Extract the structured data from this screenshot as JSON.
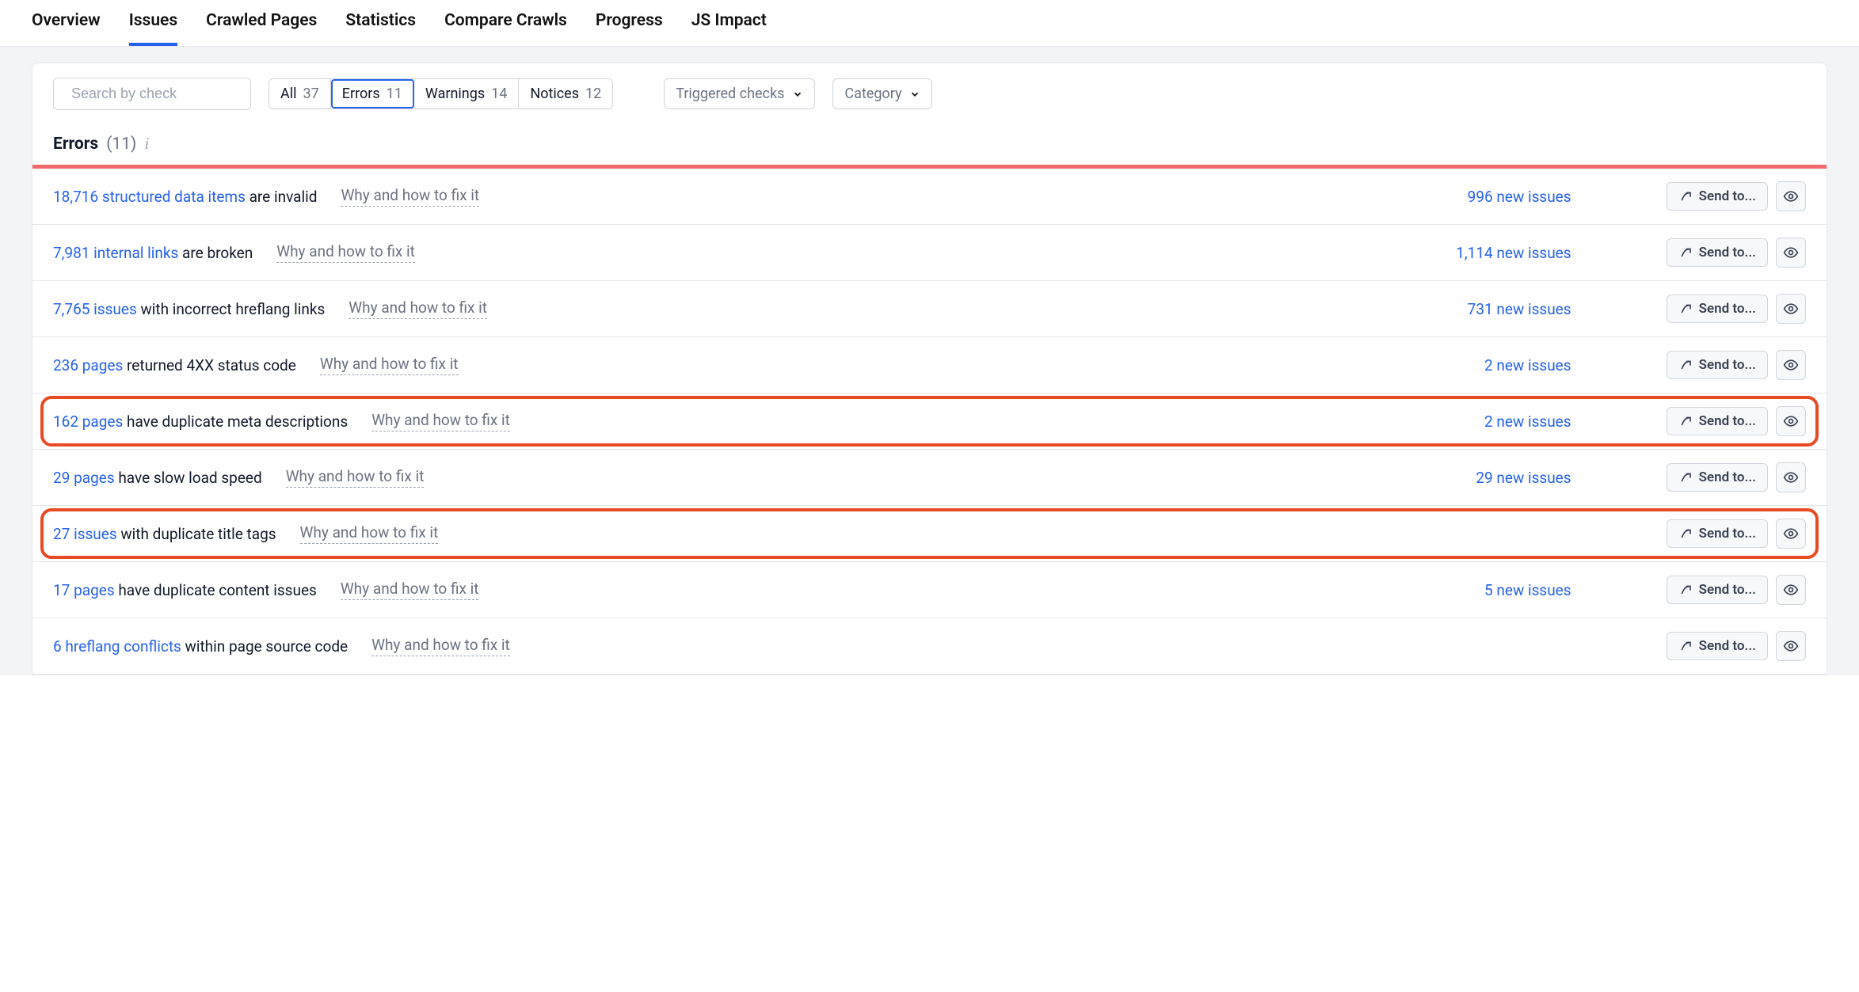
{
  "nav": {
    "items": [
      {
        "label": "Overview"
      },
      {
        "label": "Issues",
        "active": true
      },
      {
        "label": "Crawled Pages"
      },
      {
        "label": "Statistics"
      },
      {
        "label": "Compare Crawls"
      },
      {
        "label": "Progress"
      },
      {
        "label": "JS Impact"
      }
    ]
  },
  "filters": {
    "search_placeholder": "Search by check",
    "segments": [
      {
        "label": "All",
        "count": "37"
      },
      {
        "label": "Errors",
        "count": "11",
        "active": true
      },
      {
        "label": "Warnings",
        "count": "14"
      },
      {
        "label": "Notices",
        "count": "12"
      }
    ],
    "triggered_label": "Triggered checks",
    "category_label": "Category"
  },
  "section": {
    "title": "Errors",
    "count_text": "(11)"
  },
  "strings": {
    "howfix": "Why and how to fix it",
    "send_to": "Send to..."
  },
  "issues": [
    {
      "link_text": "18,716 structured data items",
      "suffix": " are invalid",
      "new_issues": "996 new issues",
      "highlight": false
    },
    {
      "link_text": "7,981 internal links",
      "suffix": " are broken",
      "new_issues": "1,114 new issues",
      "highlight": false
    },
    {
      "link_text": "7,765 issues",
      "suffix": " with incorrect hreflang links",
      "new_issues": "731 new issues",
      "highlight": false
    },
    {
      "link_text": "236 pages",
      "suffix": " returned 4XX status code",
      "new_issues": "2 new issues",
      "highlight": false
    },
    {
      "link_text": "162 pages",
      "suffix": " have duplicate meta descriptions",
      "new_issues": "2 new issues",
      "highlight": true
    },
    {
      "link_text": "29 pages",
      "suffix": " have slow load speed",
      "new_issues": "29 new issues",
      "highlight": false
    },
    {
      "link_text": "27 issues",
      "suffix": " with duplicate title tags",
      "new_issues": "",
      "highlight": true
    },
    {
      "link_text": "17 pages",
      "suffix": " have duplicate content issues",
      "new_issues": "5 new issues",
      "highlight": false
    },
    {
      "link_text": "6 hreflang conflicts",
      "suffix": " within page source code",
      "new_issues": "",
      "highlight": false
    }
  ]
}
